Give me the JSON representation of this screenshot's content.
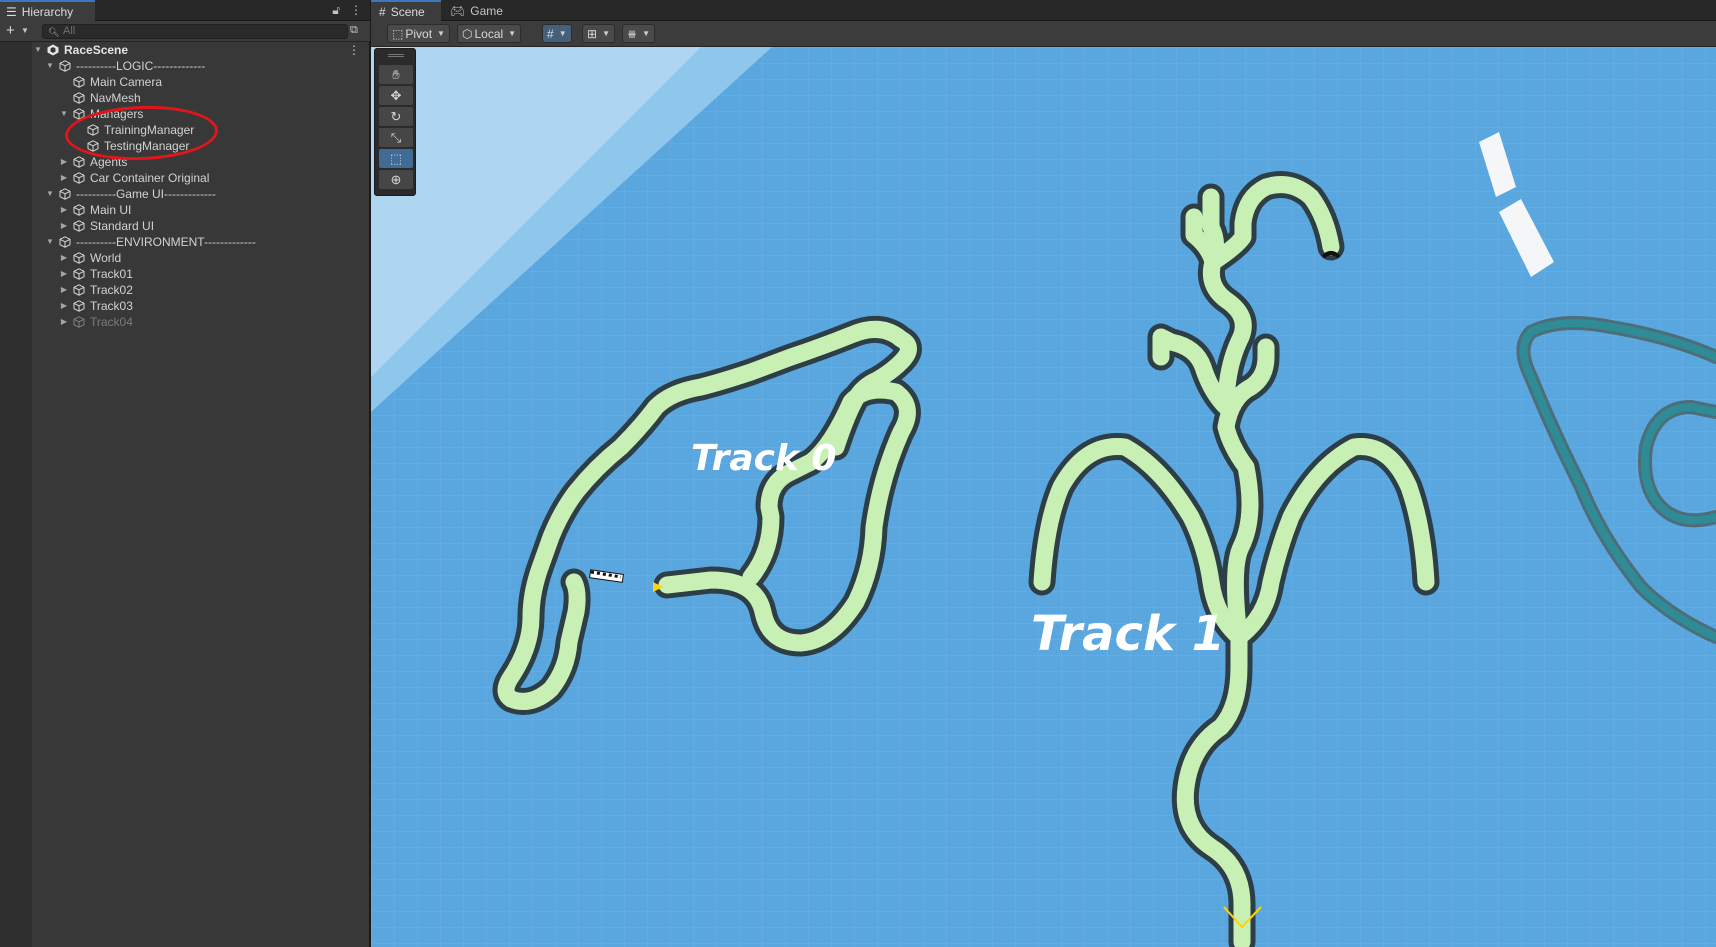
{
  "hierarchy": {
    "tab_label": "Hierarchy",
    "search_placeholder": "All",
    "scene_name": "RaceScene",
    "items": [
      {
        "label": "----------LOGIC-------------",
        "depth": 1,
        "arrow": "down"
      },
      {
        "label": "Main Camera",
        "depth": 2,
        "arrow": "none"
      },
      {
        "label": "NavMesh",
        "depth": 2,
        "arrow": "none"
      },
      {
        "label": "Managers",
        "depth": 2,
        "arrow": "down"
      },
      {
        "label": "TrainingManager",
        "depth": 3,
        "arrow": "none"
      },
      {
        "label": "TestingManager",
        "depth": 3,
        "arrow": "none"
      },
      {
        "label": "Agents",
        "depth": 2,
        "arrow": "right"
      },
      {
        "label": "Car Container Original",
        "depth": 2,
        "arrow": "right"
      },
      {
        "label": "----------Game UI-------------",
        "depth": 1,
        "arrow": "down"
      },
      {
        "label": "Main UI",
        "depth": 2,
        "arrow": "right"
      },
      {
        "label": "Standard UI",
        "depth": 2,
        "arrow": "right"
      },
      {
        "label": "----------ENVIRONMENT-------------",
        "depth": 1,
        "arrow": "down"
      },
      {
        "label": "World",
        "depth": 2,
        "arrow": "right"
      },
      {
        "label": "Track01",
        "depth": 2,
        "arrow": "right"
      },
      {
        "label": "Track02",
        "depth": 2,
        "arrow": "right"
      },
      {
        "label": "Track03",
        "depth": 2,
        "arrow": "right"
      },
      {
        "label": "Track04",
        "depth": 2,
        "arrow": "right",
        "disabled": true
      }
    ]
  },
  "scene": {
    "tabs": [
      "Scene",
      "Game"
    ],
    "toolbar": {
      "pivot": "Pivot",
      "local": "Local"
    },
    "labels": {
      "track0": "Track 0",
      "track1": "Track 1"
    }
  },
  "colors": {
    "track_fill": "#c9f0b4",
    "ground": "#5aa6de",
    "teal_track": "#2f8c97",
    "annotation": "#e0161c"
  }
}
